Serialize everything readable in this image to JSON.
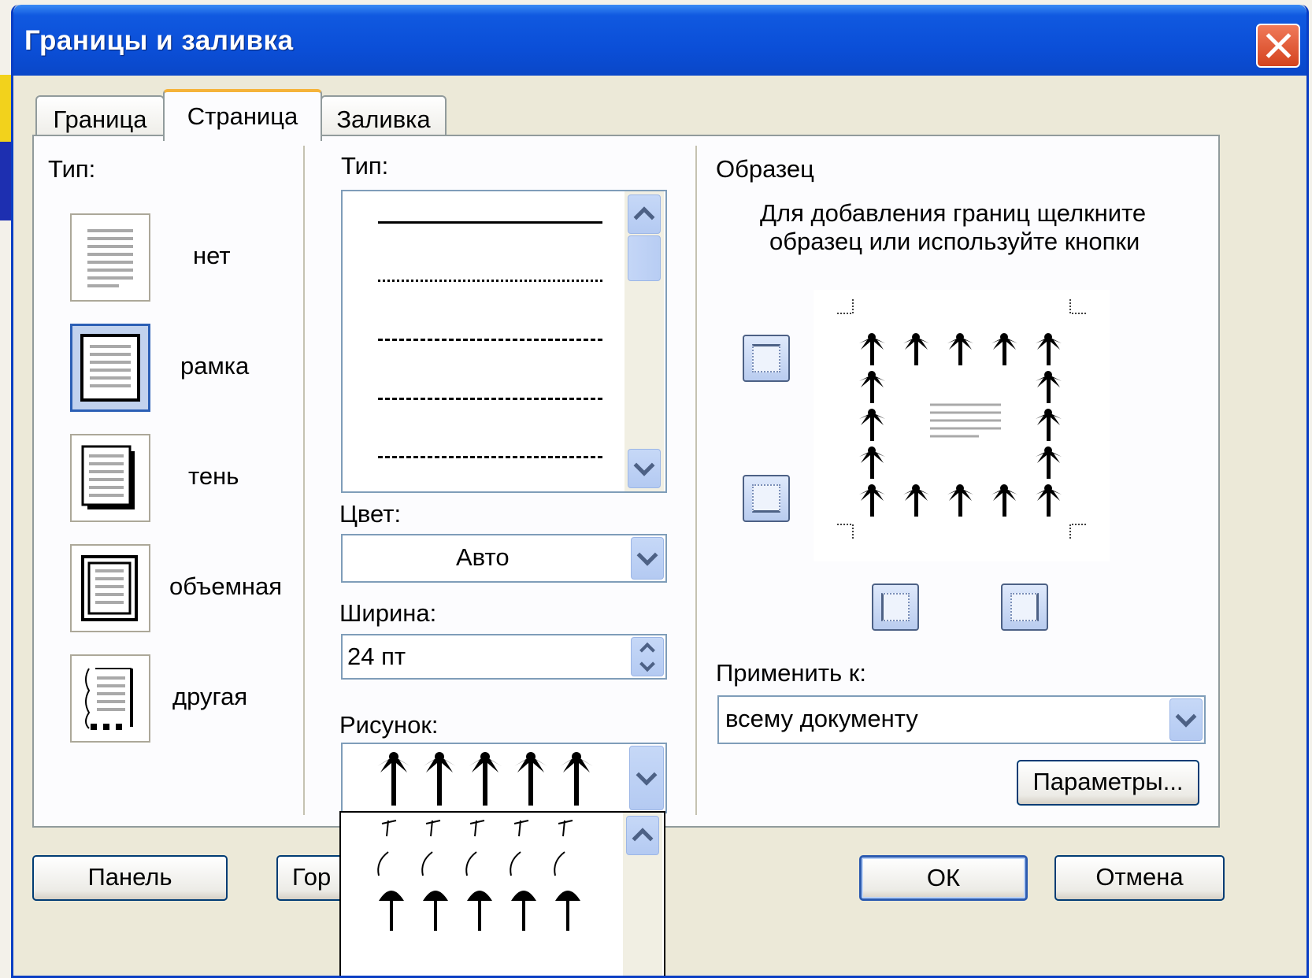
{
  "window": {
    "title": "Границы и заливка"
  },
  "tabs": [
    {
      "label": "Граница",
      "active": false
    },
    {
      "label": "Страница",
      "active": true
    },
    {
      "label": "Заливка",
      "active": false
    }
  ],
  "setting": {
    "label": "Тип:",
    "options": [
      {
        "label": "нет",
        "selected": false
      },
      {
        "label": "рамка",
        "selected": true
      },
      {
        "label": "тень",
        "selected": false
      },
      {
        "label": "объемная",
        "selected": false
      },
      {
        "label": "другая",
        "selected": false
      }
    ]
  },
  "style": {
    "label": "Тип:",
    "color_label": "Цвет:",
    "color_value": "Авто",
    "width_label": "Ширина:",
    "width_value": "24 пт",
    "art_label": "Рисунок:"
  },
  "preview": {
    "label": "Образец",
    "hint_line1": "Для добавления границ щелкните",
    "hint_line2": "образец или используйте кнопки"
  },
  "apply": {
    "label": "Применить к:",
    "value": "всему документу",
    "options_button": "Параметры..."
  },
  "footer": {
    "panel_button": "Панель",
    "horizontal_button_partial": "Гор",
    "ok_button": "ОК",
    "cancel_button": "Отмена"
  }
}
